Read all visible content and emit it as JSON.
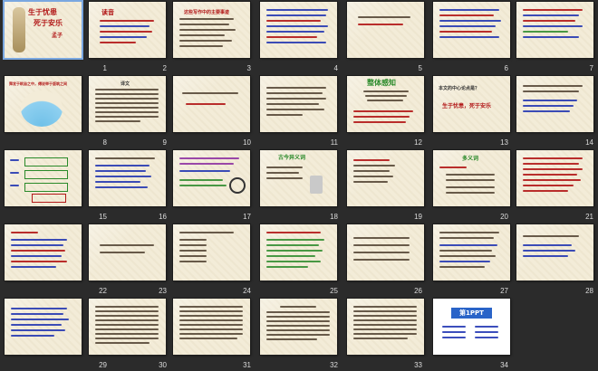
{
  "slides": [
    {
      "number": "1",
      "title_line1": "生于忧患",
      "title_line2": "死于安乐",
      "author": "孟子"
    },
    {
      "number": "2",
      "title": "读音",
      "text": ""
    },
    {
      "number": "3",
      "title": "这些写作中的主要事迹",
      "text": ""
    },
    {
      "number": "4",
      "title": "",
      "text": ""
    },
    {
      "number": "5",
      "title": "",
      "text": ""
    },
    {
      "number": "6",
      "title": "",
      "text": ""
    },
    {
      "number": "7",
      "title": "",
      "text": ""
    },
    {
      "number": "8",
      "title": "舜发于畎亩之中，傅说举于版筑之间",
      "text": ""
    },
    {
      "number": "9",
      "title": "译文",
      "text": ""
    },
    {
      "number": "10",
      "title": "",
      "text": ""
    },
    {
      "number": "11",
      "title": "",
      "text": ""
    },
    {
      "number": "12",
      "title": "整体感知",
      "text": ""
    },
    {
      "number": "13",
      "title": "本文的中心论点是？",
      "text": "生于忧患，死于安乐"
    },
    {
      "number": "14",
      "title": "",
      "text": ""
    },
    {
      "number": "15",
      "title": "",
      "text": ""
    },
    {
      "number": "16",
      "title": "",
      "text": ""
    },
    {
      "number": "17",
      "title": "",
      "text": ""
    },
    {
      "number": "18",
      "title": "古今异义词",
      "text": ""
    },
    {
      "number": "19",
      "title": "",
      "text": ""
    },
    {
      "number": "20",
      "title": "多义词",
      "text": ""
    },
    {
      "number": "21",
      "title": "",
      "text": ""
    },
    {
      "number": "22",
      "title": "",
      "text": ""
    },
    {
      "number": "23",
      "title": "",
      "text": ""
    },
    {
      "number": "24",
      "title": "",
      "text": ""
    },
    {
      "number": "25",
      "title": "",
      "text": ""
    },
    {
      "number": "26",
      "title": "",
      "text": ""
    },
    {
      "number": "27",
      "title": "",
      "text": ""
    },
    {
      "number": "28",
      "title": "",
      "text": ""
    },
    {
      "number": "29",
      "title": "",
      "text": ""
    },
    {
      "number": "30",
      "title": "",
      "text": ""
    },
    {
      "number": "31",
      "title": "",
      "text": ""
    },
    {
      "number": "32",
      "title": "",
      "text": ""
    },
    {
      "number": "33",
      "title": "",
      "text": ""
    },
    {
      "number": "34",
      "title": "第1PPT",
      "text": ""
    }
  ],
  "colors": {
    "background": "#2b2b2b",
    "slide": "#f3ecd8",
    "red": "#b21818",
    "blue": "#1a2fb0",
    "green": "#2a8a2a"
  }
}
